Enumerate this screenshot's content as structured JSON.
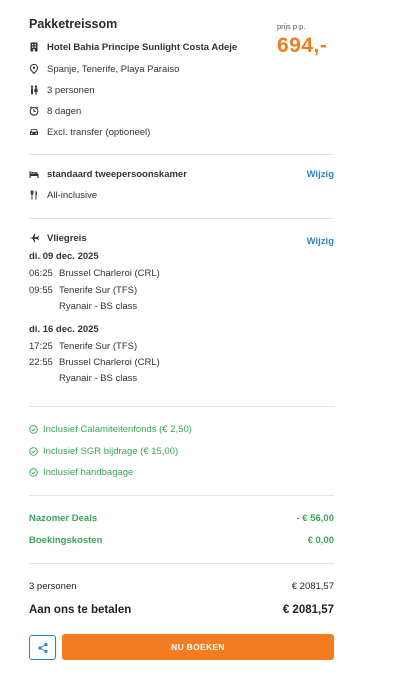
{
  "header": {
    "title": "Pakketreissom",
    "price_label": "prijs p.p.",
    "price": "694,-"
  },
  "package": {
    "hotel": "Hotel Bahia Principe Sunlight Costa Adeje",
    "location": "Spanje, Tenerife, Playa Paraiso",
    "persons": "3 personen",
    "duration": "8 dagen",
    "transfer": "Excl. transfer",
    "transfer_note": "(optioneel)"
  },
  "room": {
    "type": "standaard tweepersoonskamer",
    "board": "All-inclusive",
    "change_label": "Wijzig"
  },
  "flight": {
    "title": "Vliegreis",
    "change_label": "Wijzig",
    "outbound": {
      "date": "di. 09 dec. 2025",
      "dep_time": "06:25",
      "dep_airport": "Brussel Charleroi (CRL)",
      "arr_time": "09:55",
      "arr_airport": "Tenerife Sur (TFS)",
      "carrier": "Ryanair - BS class"
    },
    "return": {
      "date": "di. 16 dec. 2025",
      "dep_time": "17:25",
      "dep_airport": "Tenerife Sur (TFS)",
      "arr_time": "22:55",
      "arr_airport": "Brussel Charleroi (CRL)",
      "carrier": "Ryanair - BS class"
    }
  },
  "inclusions": [
    "Inclusief Calamiteitenfonds (€ 2,50)",
    "Inclusief SGR bijdrage (€ 15,00)",
    "Inclusief handbagage"
  ],
  "discounts": [
    {
      "label": "Nazomer Deals",
      "value": "- € 56,00"
    },
    {
      "label": "Boekingskosten",
      "value": "€ 0,00"
    }
  ],
  "totals": {
    "persons_label": "3 personen",
    "persons_value": "€ 2081,57",
    "pay_label": "Aan ons te betalen",
    "pay_value": "€ 2081,57"
  },
  "actions": {
    "book_label": "NU BOEKEN"
  },
  "colors": {
    "accent": "#f47b20",
    "link": "#2c86c4",
    "positive": "#3aa655"
  }
}
